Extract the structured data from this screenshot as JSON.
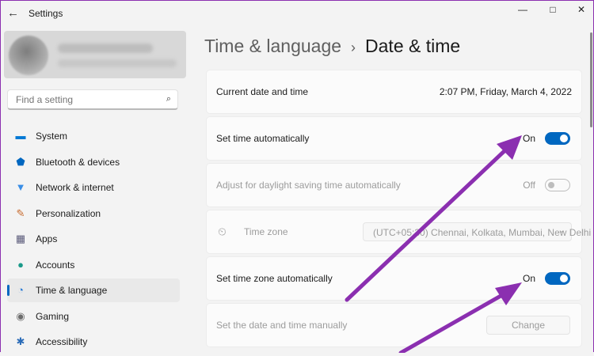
{
  "window": {
    "title": "Settings",
    "back_icon": "←",
    "minimize_icon": "—",
    "maximize_icon": "□",
    "close_icon": "✕"
  },
  "search": {
    "placeholder": "Find a setting",
    "icon": "⌕"
  },
  "sidebar": {
    "items": [
      {
        "label": "System",
        "icon": "▬",
        "color": "#0078d4"
      },
      {
        "label": "Bluetooth & devices",
        "icon": "⬟",
        "color": "#0067c0"
      },
      {
        "label": "Network & internet",
        "icon": "▼",
        "color": "#3a8ee6"
      },
      {
        "label": "Personalization",
        "icon": "✎",
        "color": "#c76b2e"
      },
      {
        "label": "Apps",
        "icon": "▦",
        "color": "#5b5b7a"
      },
      {
        "label": "Accounts",
        "icon": "●",
        "color": "#1b9a8a"
      },
      {
        "label": "Time & language",
        "icon": "◔",
        "color": "#2b7bd4"
      },
      {
        "label": "Gaming",
        "icon": "◉",
        "color": "#6d6d6d"
      },
      {
        "label": "Accessibility",
        "icon": "✱",
        "color": "#2b6cb8"
      }
    ]
  },
  "breadcrumb": {
    "parent": "Time & language",
    "separator": "›",
    "current": "Date & time"
  },
  "settings": {
    "current_datetime": {
      "label": "Current date and time",
      "value": "2:07 PM, Friday, March 4, 2022"
    },
    "set_time_auto": {
      "label": "Set time automatically",
      "state": "On"
    },
    "daylight": {
      "label": "Adjust for daylight saving time automatically",
      "state": "Off"
    },
    "timezone": {
      "icon": "⏲",
      "label": "Time zone",
      "value": "(UTC+05:30) Chennai, Kolkata, Mumbai, New Delhi",
      "chevron": "⌄"
    },
    "set_tz_auto": {
      "label": "Set time zone automatically",
      "state": "On"
    },
    "manual": {
      "label": "Set the date and time manually",
      "button": "Change"
    }
  },
  "colors": {
    "accent": "#0067c0",
    "annotation_arrow": "#8b2fb0"
  }
}
